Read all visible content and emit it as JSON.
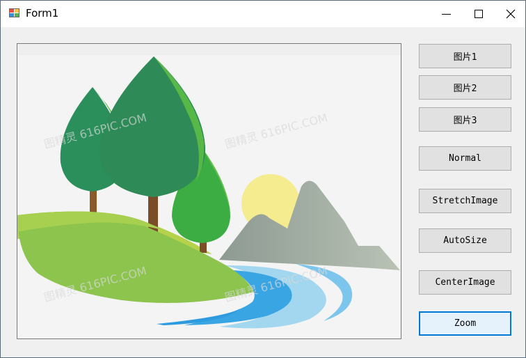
{
  "window": {
    "title": "Form1"
  },
  "buttons": {
    "pic1": "图片1",
    "pic2": "图片2",
    "pic3": "图片3",
    "normal": "Normal",
    "stretch": "StretchImage",
    "autosize": "AutoSize",
    "center": "CenterImage",
    "zoom": "Zoom"
  },
  "picture": {
    "watermark": "图精灵 616PIC.COM",
    "content": [
      "trees",
      "green-hill",
      "sun",
      "mountains",
      "river"
    ]
  },
  "colors": {
    "focus_border": "#0078d7",
    "button_face": "#e1e1e1",
    "form_bg": "#f0f0f0"
  }
}
